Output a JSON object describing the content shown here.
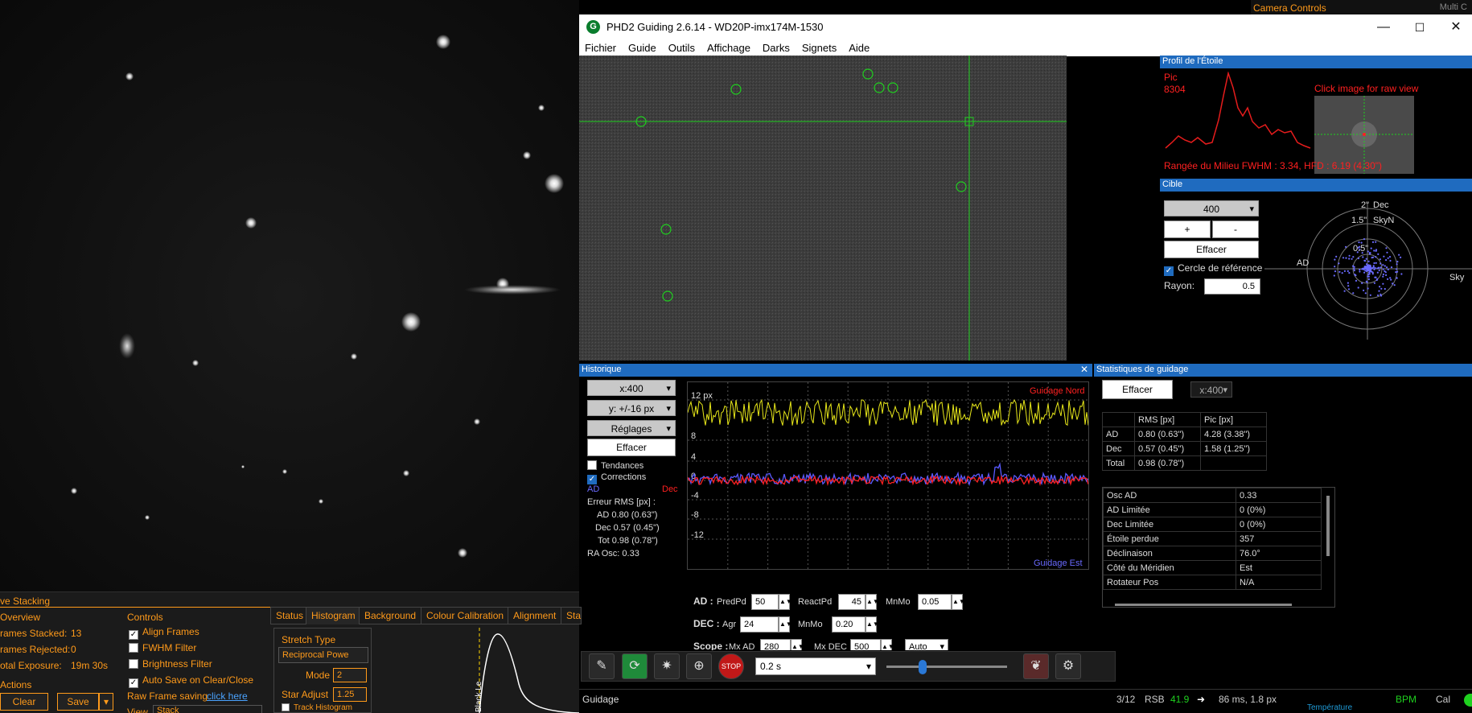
{
  "camera_controls": {
    "title": "Camera Controls",
    "multi": "Multi C"
  },
  "phd": {
    "title": "PHD2 Guiding 2.6.14 - WD20P-imx174M-1530",
    "menu": [
      "Fichier",
      "Guide",
      "Outils",
      "Affichage",
      "Darks",
      "Signets",
      "Aide"
    ],
    "window_buttons": [
      "—",
      "☐",
      "✕"
    ]
  },
  "profile": {
    "title": "Profil de l'Étoile",
    "peak_label": "Pic",
    "peak_value": "8304",
    "raw_hint": "Click image for raw view",
    "metrics": "Rangée du Milieu FWHM : 3.34, HFD : 6.19 (4.30\")"
  },
  "target": {
    "title": "Cible",
    "scale": "400",
    "plus": "+",
    "minus": "-",
    "clear": "Effacer",
    "ref_circle": "Cercle de référence",
    "radius_label": "Rayon:",
    "radius_value": "0.5",
    "ring_labels": [
      "2\"",
      "1.5\"",
      "0.5\""
    ],
    "axis_dec": "Dec",
    "axis_skyn": "SkyN",
    "axis_ad": "AD",
    "axis_sky": "Sky"
  },
  "history": {
    "title": "Historique",
    "x_scale": "x:400",
    "y_scale": "y: +/-16 px",
    "settings": "Réglages",
    "clear": "Effacer",
    "trends": "Tendances",
    "corrections": "Corrections",
    "legend_ad": "AD",
    "legend_dec": "Dec",
    "rms_title": "Erreur RMS [px] :",
    "rms_ad": "AD  0.80 (0.63\")",
    "rms_dec": "Dec  0.57 (0.45\")",
    "rms_tot": "Tot  0.98 (0.78\")",
    "ra_osc": "RA Osc: 0.33",
    "y_ticks": [
      "12 px",
      "8",
      "4",
      "0",
      "-4",
      "-8",
      "-12"
    ],
    "guide_north": "Guidage Nord",
    "guide_east": "Guidage Est",
    "ad_label": "AD :",
    "ad_predpd": "PredPd",
    "ad_predpd_val": "50",
    "ad_reactpd": "ReactPd",
    "ad_reactpd_val": "45",
    "ad_mnmo": "MnMo",
    "ad_mnmo_val": "0.05",
    "dec_label": "DEC :",
    "dec_agr": "Agr",
    "dec_agr_val": "24",
    "dec_mnmo": "MnMo",
    "dec_mnmo_val": "0.20",
    "scope_label": "Scope :",
    "mx_ad": "Mx AD",
    "mx_ad_val": "280",
    "mx_dec": "Mx DEC",
    "mx_dec_val": "500",
    "auto": "Auto"
  },
  "stats": {
    "title": "Statistiques de guidage",
    "clear": "Effacer",
    "scale": "x:400",
    "rms_header": [
      "",
      "RMS [px]",
      "Pic [px]"
    ],
    "rms_rows": [
      [
        "AD",
        "0.80 (0.63\")",
        "4.28 (3.38\")"
      ],
      [
        "Dec",
        "0.57 (0.45\")",
        "1.58 (1.25\")"
      ],
      [
        "Total",
        "0.98 (0.78\")",
        ""
      ]
    ],
    "info_rows": [
      [
        "Osc AD",
        "0.33"
      ],
      [
        "AD Limitée",
        "0 (0%)"
      ],
      [
        "Dec Limitée",
        "0 (0%)"
      ],
      [
        "Étoile perdue",
        "357"
      ],
      [
        "Déclinaison",
        "76.0°"
      ],
      [
        "Côté du Méridien",
        "Est"
      ],
      [
        "Rotateur Pos",
        "N/A"
      ]
    ]
  },
  "toolbar": {
    "exposure": "0.2 s"
  },
  "status": {
    "left": "Guidage",
    "frame": "3/12",
    "rsb_label": "RSB",
    "rsb_value": "41.9",
    "timing": "86 ms, 1.8 px",
    "bpm": "BPM",
    "cal": "Cal",
    "temperature": "Température"
  },
  "stacking": {
    "title": "ve Stacking",
    "overview": "Overview",
    "frames_stacked_label": "rames Stacked:",
    "frames_stacked": "13",
    "frames_rejected_label": "rames Rejected:",
    "frames_rejected": "0",
    "total_exposure_label": "otal Exposure:",
    "total_exposure": "19m 30s",
    "actions": "Actions",
    "clear": "Clear",
    "save": "Save",
    "controls": "Controls",
    "align": "Align Frames",
    "fwhm": "FWHM Filter",
    "brightness": "Brightness Filter",
    "autosave": "Auto Save on Clear/Close",
    "raw_saving": "Raw Frame saving",
    "click_here": "click here",
    "view_label": "View",
    "view_value": "Stack",
    "tabs": [
      "Status",
      "Histogram",
      "Background",
      "Colour Calibration",
      "Alignment",
      "Sta"
    ],
    "stretch_type": "Stretch Type",
    "stretch_value": "Reciprocal Powe",
    "mode_label": "Mode",
    "mode_value": "2",
    "star_adjust_label": "Star Adjust",
    "star_adjust_value": "1.25",
    "track_hist": "Track Histogram",
    "black_level": "Black Le"
  }
}
